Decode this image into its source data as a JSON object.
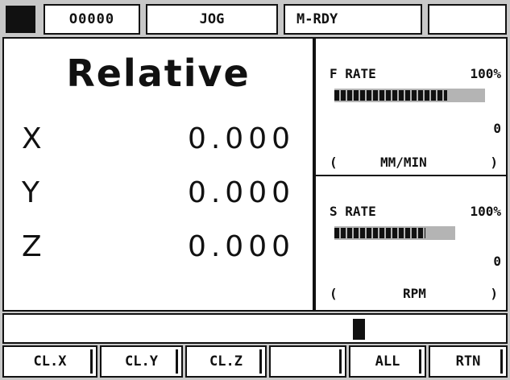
{
  "status_bar": {
    "program": "O0000",
    "mode": "JOG",
    "state": "M-RDY",
    "extra": ""
  },
  "position": {
    "title": "Relative",
    "axes": [
      {
        "name": "X",
        "value": "0.000"
      },
      {
        "name": "Y",
        "value": "0.000"
      },
      {
        "name": "Z",
        "value": "0.000"
      }
    ]
  },
  "feed": {
    "label": "F RATE",
    "percent_text": "100%",
    "override_fraction": 0.75,
    "actual": "0",
    "unit_open": "(",
    "unit": "MM/MIN",
    "unit_close": ")"
  },
  "spindle": {
    "label": "S RATE",
    "percent_text": "100%",
    "override_fraction": 0.75,
    "actual": "0",
    "unit_open": "(",
    "unit": "RPM",
    "unit_close": ")"
  },
  "softkeys": [
    "CL.X",
    "CL.Y",
    "CL.Z",
    "",
    "ALL",
    "RTN"
  ]
}
